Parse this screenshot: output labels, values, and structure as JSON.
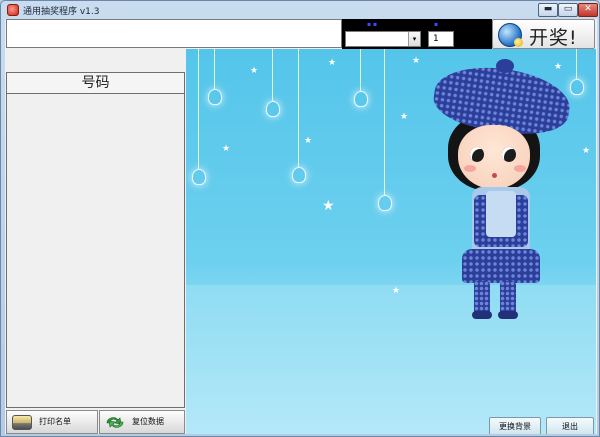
{
  "window": {
    "title": "通用抽奖程序 v1.3",
    "minimize_glyph": "▬",
    "maximize_glyph": "▭",
    "close_glyph": "✕"
  },
  "toolbar": {
    "name_input_value": "",
    "combo_value": "",
    "combo_arrow": "▾",
    "count_value": "1",
    "start_label": "开奖!"
  },
  "list": {
    "header": "号码"
  },
  "buttons": {
    "print_label": "打印名单",
    "reset_label": "复位数据",
    "change_bg_label": "更换背景",
    "exit_label": "退出"
  },
  "icons": {
    "app": "app-icon",
    "start": "lottery-icon",
    "print": "printer-icon",
    "reset": "recycle-icon"
  }
}
